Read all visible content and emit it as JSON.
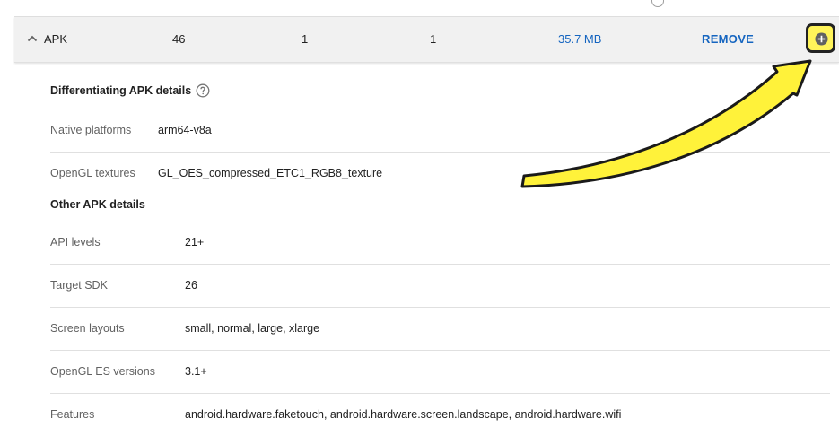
{
  "apk_row": {
    "name": "APK",
    "col_a": "46",
    "col_b": "1",
    "col_c": "1",
    "size": "35.7 MB",
    "remove_label": "REMOVE",
    "expand_icon": "chevron-up-icon",
    "add_icon": "plus-circle-icon"
  },
  "differentiating": {
    "title": "Differentiating APK details",
    "help_icon": "help-circle-icon",
    "rows": [
      {
        "label": "Native platforms",
        "value": "arm64-v8a"
      },
      {
        "label": "OpenGL textures",
        "value": "GL_OES_compressed_ETC1_RGB8_texture"
      }
    ]
  },
  "other": {
    "title": "Other APK details",
    "rows": [
      {
        "label": "API levels",
        "value": "21+"
      },
      {
        "label": "Target SDK",
        "value": "26"
      },
      {
        "label": "Screen layouts",
        "value": "small, normal, large, xlarge"
      },
      {
        "label": "OpenGL ES versions",
        "value": "3.1+"
      },
      {
        "label": "Features",
        "value": "android.hardware.faketouch, android.hardware.screen.landscape, android.hardware.wifi"
      }
    ]
  },
  "annotation": {
    "arrow_color": "#fff23a",
    "highlight_color": "#fff45a"
  }
}
